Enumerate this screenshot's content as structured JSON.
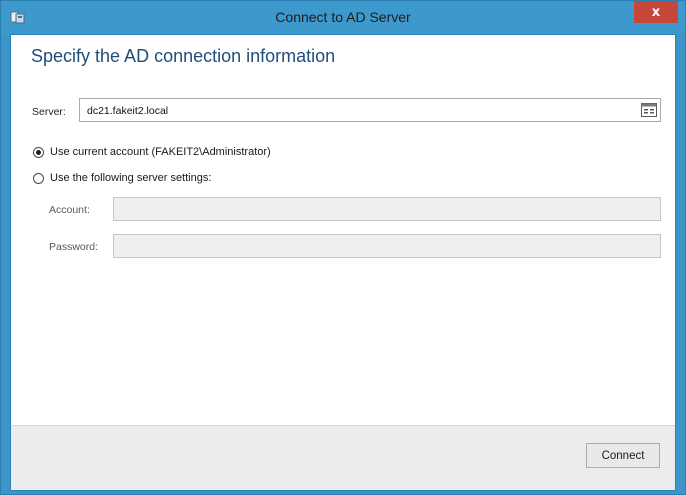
{
  "window": {
    "title": "Connect to AD Server",
    "close_glyph": "x"
  },
  "dialog": {
    "heading": "Specify the AD connection information",
    "server": {
      "label": "Server:",
      "value": "dc21.fakeit2.local"
    },
    "options": [
      {
        "label": "Use current account (FAKEIT2\\Administrator)",
        "checked": true
      },
      {
        "label": "Use the following server settings:",
        "checked": false
      }
    ],
    "account": {
      "label": "Account:",
      "value": ""
    },
    "password": {
      "label": "Password:",
      "value": ""
    }
  },
  "footer": {
    "connect_label": "Connect"
  },
  "colors": {
    "titlebar": "#3d98cc",
    "heading": "#1e4e79",
    "close": "#c7463b"
  },
  "icons": {
    "app": "app-icon",
    "close": "close-icon",
    "browse": "browse-icon"
  }
}
